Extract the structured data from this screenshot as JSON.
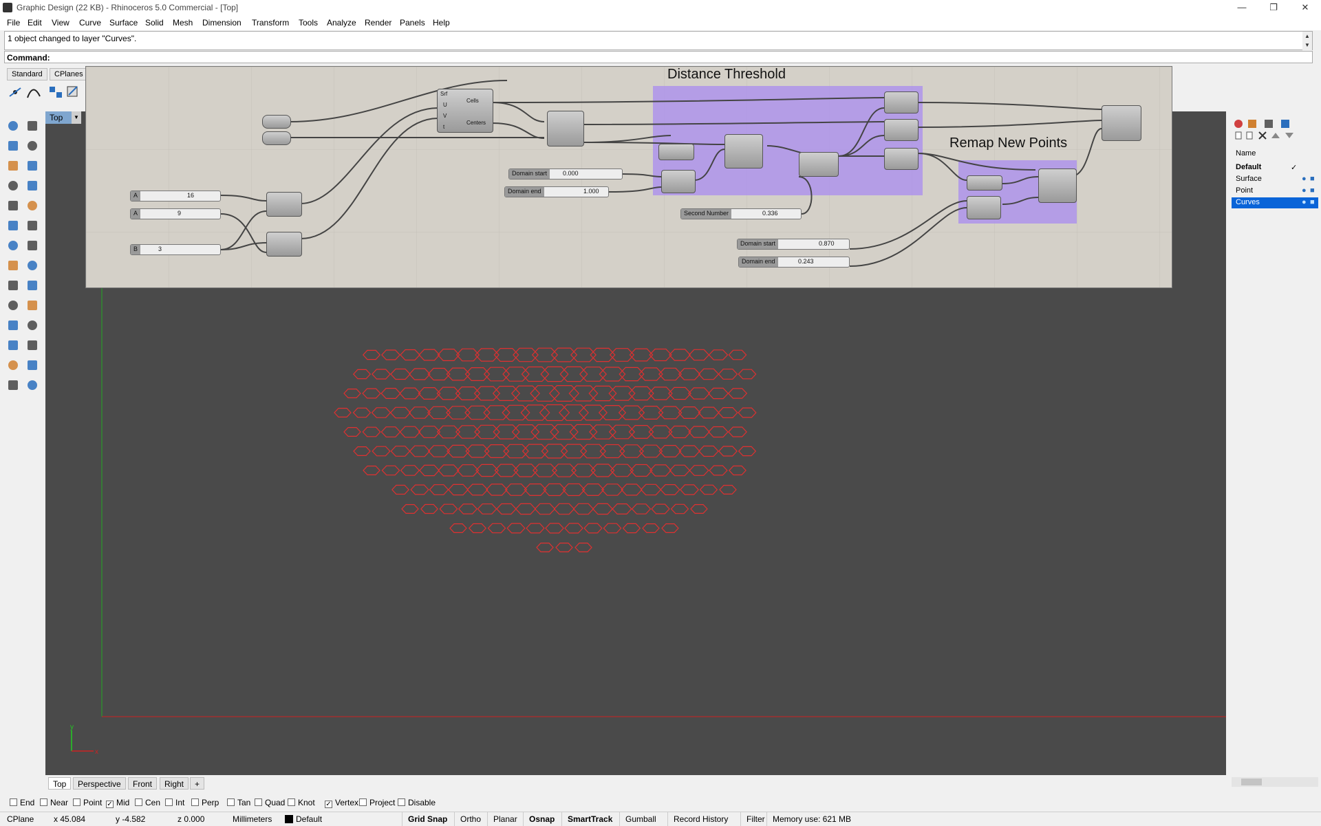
{
  "window": {
    "title": "Graphic Design (22 KB) - Rhinoceros 5.0 Commercial - [Top]"
  },
  "menu": [
    "File",
    "Edit",
    "View",
    "Curve",
    "Surface",
    "Solid",
    "Mesh",
    "Dimension",
    "Transform",
    "Tools",
    "Analyze",
    "Render",
    "Panels",
    "Help"
  ],
  "command": {
    "history": "1 object changed to layer \"Curves\".",
    "prompt": "Command:"
  },
  "toolbar_tabs": [
    "Standard",
    "CPlanes"
  ],
  "viewport": {
    "active": "Top",
    "curve_color": "#e03030",
    "background": "#4a4a4a"
  },
  "grasshopper": {
    "groups": [
      {
        "title": "Distance Threshold"
      },
      {
        "title": "Remap New Points"
      }
    ],
    "sliders": [
      {
        "label": "A",
        "value": "16"
      },
      {
        "label": "A",
        "value": "9"
      },
      {
        "label": "B",
        "value": "3"
      },
      {
        "label": "Domain start",
        "value": "0.000"
      },
      {
        "label": "Domain end",
        "value": "1.000"
      },
      {
        "label": "Second Number",
        "value": "0.336"
      },
      {
        "label": "Domain start",
        "value": "0.870"
      },
      {
        "label": "Domain end",
        "value": "0.243"
      }
    ],
    "node_labels": {
      "cells": "Cells",
      "centers": "Centers",
      "srf": "Srf",
      "u": "U",
      "v": "V",
      "t": "t"
    }
  },
  "layers": {
    "header": "Name",
    "items": [
      {
        "name": "Default",
        "check": "✓"
      },
      {
        "name": "Surface"
      },
      {
        "name": "Point"
      },
      {
        "name": "Curves"
      }
    ]
  },
  "view_tabs": [
    "Top",
    "Perspective",
    "Front",
    "Right"
  ],
  "osnap": [
    {
      "label": "End",
      "checked": false
    },
    {
      "label": "Near",
      "checked": false
    },
    {
      "label": "Point",
      "checked": false
    },
    {
      "label": "Mid",
      "checked": true
    },
    {
      "label": "Cen",
      "checked": false
    },
    {
      "label": "Int",
      "checked": false
    },
    {
      "label": "Perp",
      "checked": false
    },
    {
      "label": "Tan",
      "checked": false
    },
    {
      "label": "Quad",
      "checked": false
    },
    {
      "label": "Knot",
      "checked": false
    },
    {
      "label": "Vertex",
      "checked": true
    },
    {
      "label": "Project",
      "checked": false
    },
    {
      "label": "Disable",
      "checked": false
    }
  ],
  "status": {
    "cplane": "CPlane",
    "x": "x 45.084",
    "y": "y -4.582",
    "z": "z 0.000",
    "units": "Millimeters",
    "layer": "Default",
    "buttons": [
      "Grid Snap",
      "Ortho",
      "Planar",
      "Osnap",
      "SmartTrack",
      "Gumball",
      "Record History",
      "Filter"
    ],
    "memory": "Memory use: 621 MB"
  }
}
